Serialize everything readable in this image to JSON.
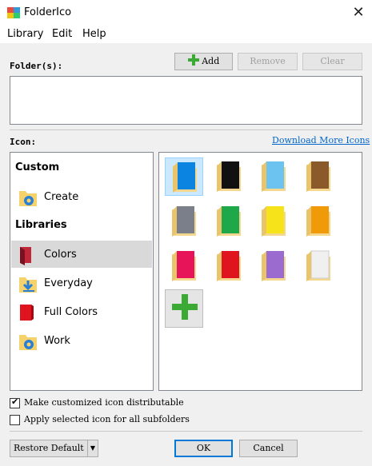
{
  "window": {
    "title": "FolderIco",
    "close_glyph": "✕"
  },
  "menu": [
    "Library",
    "Edit",
    "Help"
  ],
  "folders": {
    "label": "Folder(s):",
    "add_label": "Add",
    "remove_label": "Remove",
    "clear_label": "Clear"
  },
  "icon_section": {
    "label": "Icon:",
    "download_link": "Download More Icons"
  },
  "sidebar": {
    "custom_heading": "Custom",
    "create_label": "Create",
    "libraries_heading": "Libraries",
    "items": [
      {
        "label": "Colors",
        "selected": true
      },
      {
        "label": "Everyday",
        "selected": false
      },
      {
        "label": "Full Colors",
        "selected": false
      },
      {
        "label": "Work",
        "selected": false
      }
    ]
  },
  "icons": {
    "tile_colors": [
      "#0a84e0",
      "#111111",
      "#6cc3f0",
      "#8b5a2b",
      "#7a7f8a",
      "#1fa84a",
      "#f7e31a",
      "#f09a0a",
      "#e8145a",
      "#e0141e",
      "#9b6bd0",
      "#f0f0f0"
    ],
    "selected_index": 0,
    "add_icon": "plus-icon"
  },
  "options": {
    "distributable_label": "Make customized icon distributable",
    "distributable_checked": true,
    "subfolders_label": "Apply selected icon for all subfolders",
    "subfolders_checked": false
  },
  "footer": {
    "restore_label": "Restore Default",
    "ok_label": "OK",
    "cancel_label": "Cancel"
  },
  "colors": {
    "accent": "#0078d7",
    "link": "#0066cc",
    "plus": "#3aaa35"
  }
}
